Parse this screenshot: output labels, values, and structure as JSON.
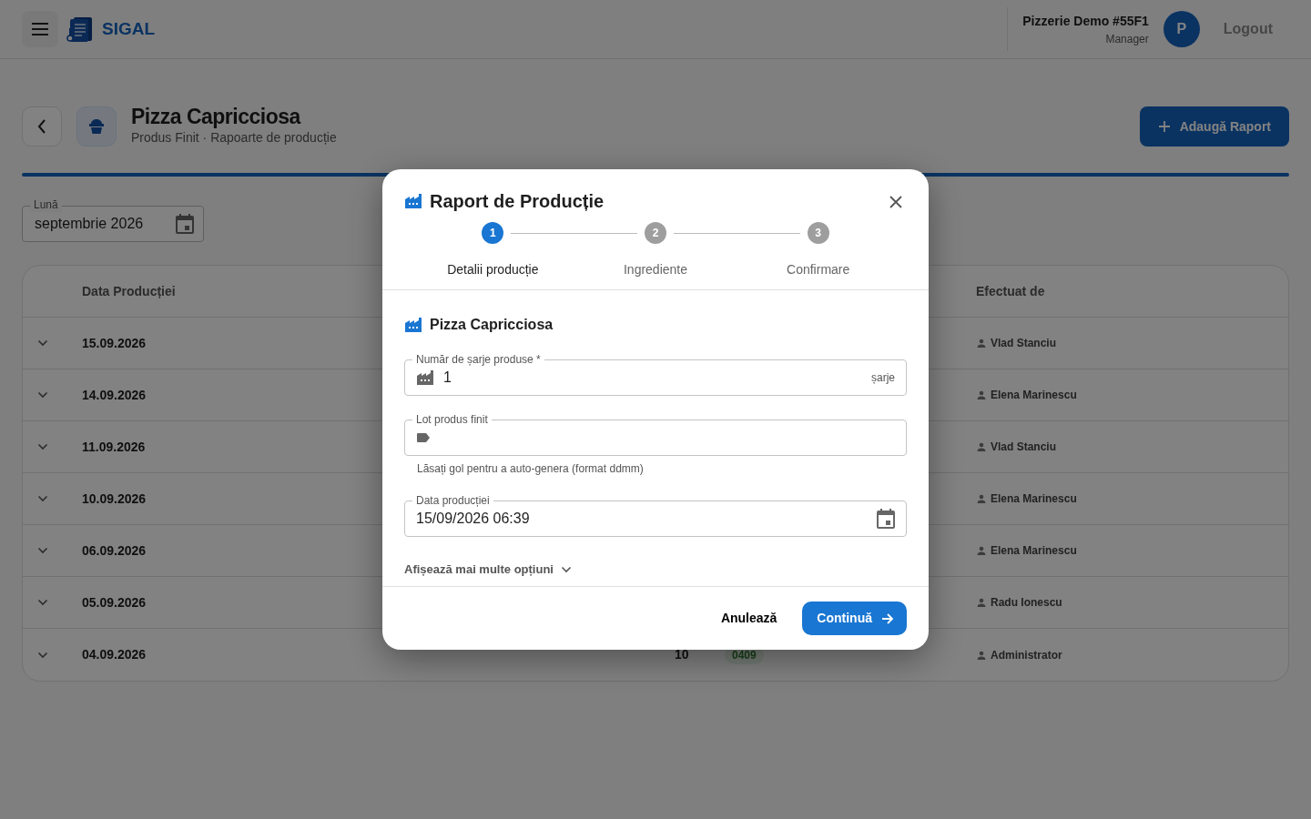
{
  "header": {
    "app_name": "SIGAL",
    "account_name": "Pizzerie Demo #55F1",
    "account_role": "Manager",
    "avatar_letter": "P",
    "logout": "Logout"
  },
  "page": {
    "title": "Pizza Capricciosa",
    "subtitle": "Produs Finit · Rapoarte de producție",
    "add_button": "Adaugă Raport"
  },
  "month_filter": {
    "label": "Lună",
    "value": "septembrie 2026"
  },
  "table": {
    "columns": [
      "Data Producției",
      "Efectuat de"
    ],
    "rows": [
      {
        "date": "15.09.2026",
        "author": "Vlad Stanciu"
      },
      {
        "date": "14.09.2026",
        "author": "Elena Marinescu"
      },
      {
        "date": "11.09.2026",
        "author": "Vlad Stanciu"
      },
      {
        "date": "10.09.2026",
        "author": "Elena Marinescu"
      },
      {
        "date": "06.09.2026",
        "author": "Elena Marinescu"
      },
      {
        "date": "05.09.2026",
        "author": "Radu Ionescu"
      },
      {
        "date": "04.09.2026",
        "author": "Administrator",
        "quantity": "10",
        "lot": "0409"
      }
    ]
  },
  "dialog": {
    "title": "Raport de Producție",
    "steps": [
      {
        "number": "1",
        "label": "Detalii producție",
        "selected": true
      },
      {
        "number": "2",
        "label": "Ingrediente",
        "selected": false
      },
      {
        "number": "3",
        "label": "Confirmare",
        "selected": false
      }
    ],
    "product": "Pizza Capricciosa",
    "fields": [
      {
        "kind": "number",
        "label": "Număr de șarje produse *",
        "value": "1",
        "suffix": "șarje"
      },
      {
        "kind": "lot",
        "label": "Lot produs finit",
        "helper": "Lăsați gol pentru a auto-genera (format ddmm)"
      },
      {
        "kind": "date",
        "label": "Data producției",
        "value": "15/09/2026 06:39"
      }
    ],
    "more_options": "Afișează mai multe opțiuni",
    "cancel": "Anulează",
    "continue": "Continuă"
  }
}
